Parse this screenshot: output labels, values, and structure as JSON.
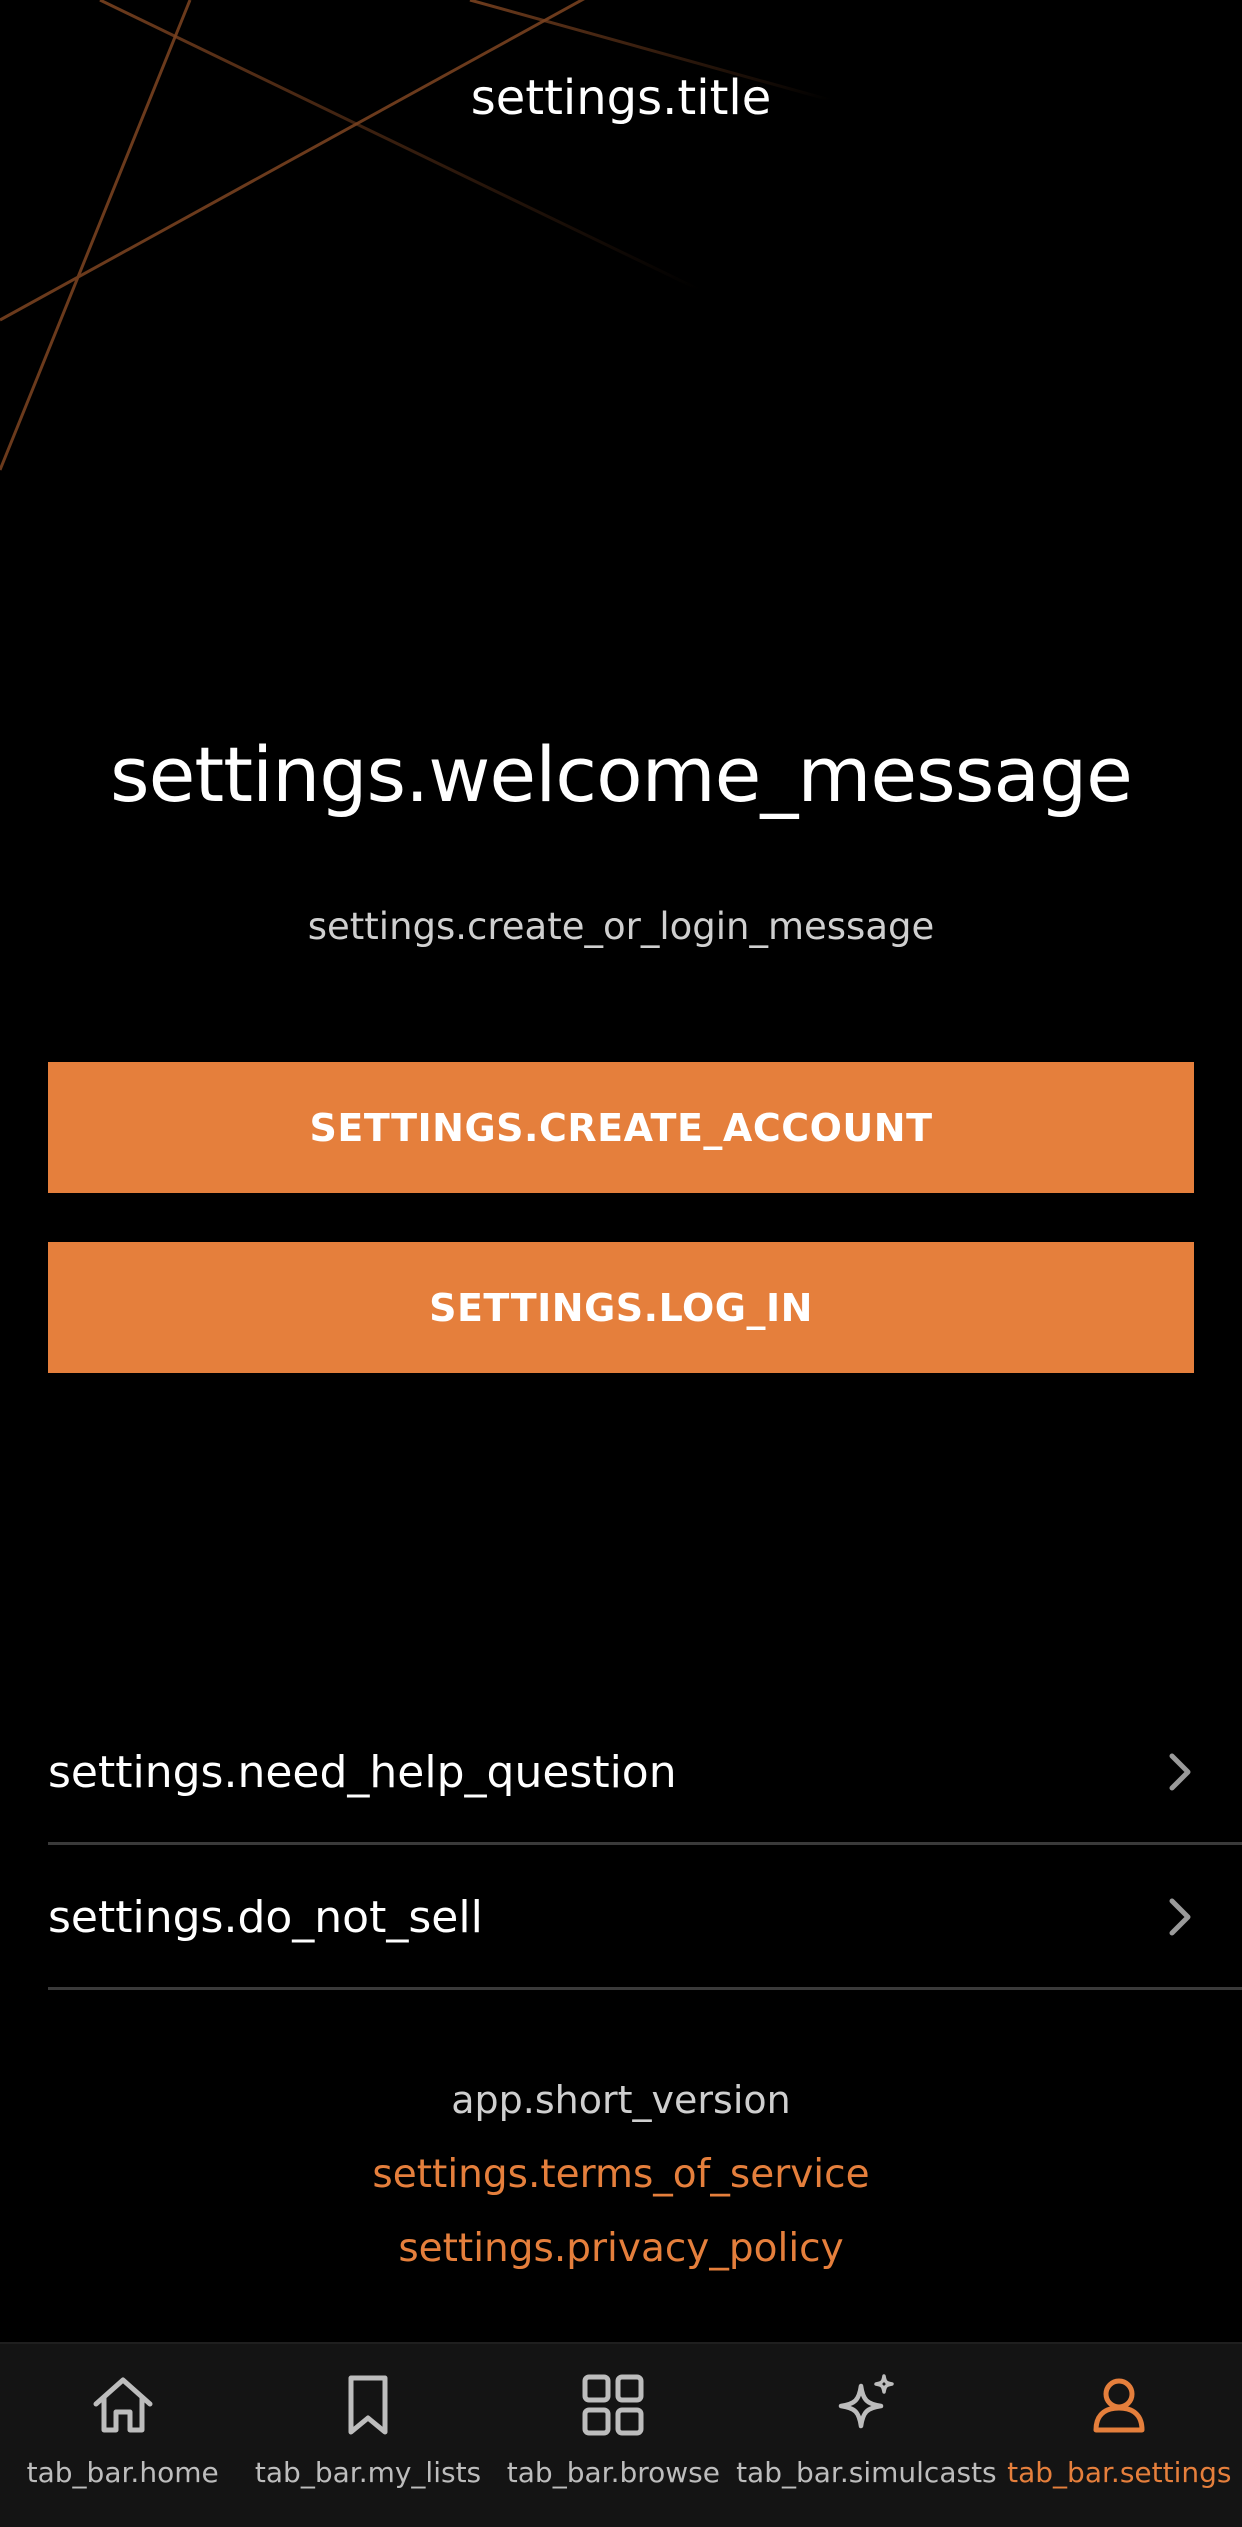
{
  "header": {
    "title": "settings.title"
  },
  "welcome": {
    "heading": "settings.welcome_message",
    "subtitle": "settings.create_or_login_message"
  },
  "buttons": {
    "create_account": "SETTINGS.CREATE_ACCOUNT",
    "log_in": "SETTINGS.LOG_IN"
  },
  "menu": {
    "items": [
      {
        "label": "settings.need_help_question",
        "icon": "chevron-right-icon"
      },
      {
        "label": "settings.do_not_sell",
        "icon": "chevron-right-icon"
      }
    ]
  },
  "footer": {
    "version": "app.short_version",
    "terms": "settings.terms_of_service",
    "privacy": "settings.privacy_policy"
  },
  "tab_bar": {
    "active": "settings",
    "items": [
      {
        "id": "home",
        "label": "tab_bar.home",
        "icon": "home-icon"
      },
      {
        "id": "my_lists",
        "label": "tab_bar.my_lists",
        "icon": "bookmark-icon"
      },
      {
        "id": "browse",
        "label": "tab_bar.browse",
        "icon": "grid-icon"
      },
      {
        "id": "simulcasts",
        "label": "tab_bar.simulcasts",
        "icon": "sparkle-icon"
      },
      {
        "id": "settings",
        "label": "tab_bar.settings",
        "icon": "user-icon"
      }
    ]
  },
  "colors": {
    "accent": "#e57f3c",
    "background": "#000000",
    "tab_bar_background": "#141414",
    "divider": "#3a3a3a"
  }
}
